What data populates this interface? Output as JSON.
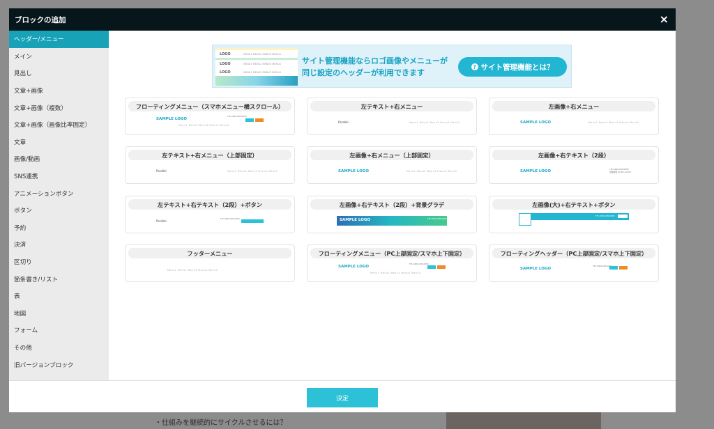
{
  "background": {
    "text": "・仕組みを継続的にサイクルさせるには？"
  },
  "modal": {
    "title": "ブロックの追加",
    "close": "×",
    "ok_label": "決定"
  },
  "sidebar": {
    "items": [
      {
        "label": "ヘッダー/メニュー",
        "active": true
      },
      {
        "label": "メイン"
      },
      {
        "label": "見出し"
      },
      {
        "label": "文章+画像"
      },
      {
        "label": "文章+画像（複数）"
      },
      {
        "label": "文章+画像（画像比率固定）"
      },
      {
        "label": "文章"
      },
      {
        "label": "画像/動画"
      },
      {
        "label": "SNS連携"
      },
      {
        "label": "アニメーションボタン"
      },
      {
        "label": "ボタン"
      },
      {
        "label": "予約"
      },
      {
        "label": "決済"
      },
      {
        "label": "区切り"
      },
      {
        "label": "箇条書き/リスト"
      },
      {
        "label": "表"
      },
      {
        "label": "地図"
      },
      {
        "label": "フォーム"
      },
      {
        "label": "その他"
      },
      {
        "label": "旧バージョンブロック"
      }
    ]
  },
  "banner": {
    "line1": "サイト管理機能ならロゴ画像やメニューが",
    "line2": "同じ設定のヘッダーが利用できます",
    "button": "サイト管理機能とは？",
    "thumb_logo": "LOGO",
    "thumb_nav": "MENU1 MENU2 MENU3 MENU4"
  },
  "preview": {
    "sample_logo": "SAMPLE LOGO",
    "parallel": "Parallel",
    "menu": "Menu1 Menu2 Menu3 Menu4 Menu5",
    "tel": "TEL:0000-000-0000",
    "sub": "営業時間 00:00〜00:00"
  },
  "cards": [
    {
      "title": "フローティングメニュー（スマホメニュー横スクロール）"
    },
    {
      "title": "左テキスト+右メニュー"
    },
    {
      "title": "左画像+右メニュー"
    },
    {
      "title": "左テキスト+右メニュー（上部固定）"
    },
    {
      "title": "左画像+右メニュー（上部固定）"
    },
    {
      "title": "左画像+右テキスト（2段）"
    },
    {
      "title": "左テキスト+右テキスト（2段）+ボタン"
    },
    {
      "title": "左画像+右テキスト（2段）+背景グラデ"
    },
    {
      "title": "左画像(大)+右テキスト+ボタン"
    },
    {
      "title": "フッターメニュー"
    },
    {
      "title": "フローティングメニュー（PC上部固定/スマホ上下固定）"
    },
    {
      "title": "フローティングヘッダー（PC上部固定/スマホ上下固定）"
    }
  ],
  "colors": {
    "accent": "#17a2b8",
    "header_bg": "#07161b",
    "button": "#2cc1d6",
    "orange": "#f08a24"
  }
}
